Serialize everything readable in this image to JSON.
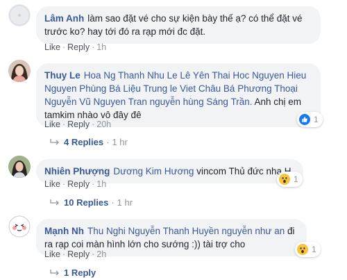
{
  "comments": [
    {
      "author": "Lâm Anh",
      "segments": [
        "làm sao đặt vé cho sự kiện bày thế ạ? có thể đặt vé trước ko? hay tới đó ra rạp mới đc đặt."
      ],
      "like": "Like",
      "reply": "Reply",
      "time": "1h"
    },
    {
      "author": "Thuy Le",
      "tags": "Hoa Ng Thanh Nhu Le Lê Yên Thai Hoc Nguyen Hieu Nguyen Phùng Bá Liệu Trung le Viet Châu Bá Phương Thoại Nguyễn Vũ Nguyen Tran nguyễn hùng Sáng Trần.",
      "text": "Anh chị em tamkim nhào vô đây đê",
      "like": "Like",
      "reply": "Reply",
      "time": "20h",
      "reaction_icon": "like-icon",
      "reaction_count": "1",
      "replies_label": "4 Replies",
      "replies_time": "1 hr"
    },
    {
      "author": "Nhiên Phượng",
      "tags": "Dương Kim Hương",
      "text": "vincom Thủ đức nha H",
      "like": "Like",
      "reply": "Reply",
      "time": "1h",
      "reaction_icon": "wow-icon",
      "reaction_count": "1",
      "replies_label": "10 Replies",
      "replies_time": "1 hr"
    },
    {
      "author": "Mạnh Nh",
      "tags": "Thu Nghi Nguyễn Thanh Huyền nguyễn như an",
      "text": "đi ra rạp coi màn hình lớn cho sướng :)) tài trợ cho",
      "like": "Like",
      "reply": "Reply",
      "time": "2h",
      "reaction_icon": "wow-icon",
      "reaction_count": "1",
      "replies_label": "1 Reply"
    }
  ],
  "separator": "·",
  "colors": {
    "link": "#385898",
    "bubble": "#f2f3f5",
    "meta": "#90949c",
    "like_blue": "#1877f2",
    "wow_yellow": "#f7c440"
  }
}
